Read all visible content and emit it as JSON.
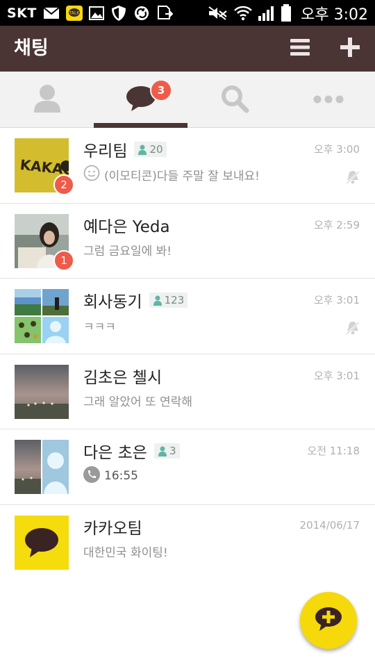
{
  "status_bar": {
    "carrier": "SKT",
    "time": "오후 3:02",
    "icons": [
      "mail-icon",
      "kakaotalk-icon",
      "image-icon",
      "shield-icon",
      "sync-icon",
      "download-icon",
      "mute-icon",
      "wifi-icon",
      "signal-icon",
      "battery-icon"
    ]
  },
  "header": {
    "title": "채팅",
    "menu_icon": "menu-icon",
    "add_icon": "plus-icon"
  },
  "tabs": {
    "items": [
      {
        "id": "friends",
        "icon": "person-icon",
        "active": false
      },
      {
        "id": "chats",
        "icon": "chat-bubble-icon",
        "active": true,
        "badge": "3"
      },
      {
        "id": "search",
        "icon": "search-icon",
        "active": false
      },
      {
        "id": "more",
        "icon": "more-dots-icon",
        "active": false
      }
    ],
    "accent": "#4a3434"
  },
  "chats": [
    {
      "name": "우리팀",
      "members": "20",
      "time": "오후 3:00",
      "preview": "(이모티콘)다들 주말 잘 보내요!",
      "preview_icon": "emoticon-icon",
      "unread": "2",
      "muted": true
    },
    {
      "name": "예다은 Yeda",
      "members": "",
      "time": "오후 2:59",
      "preview": "그럼 금요일에 봐!",
      "preview_icon": "",
      "unread": "1",
      "muted": false
    },
    {
      "name": "회사동기",
      "members": "123",
      "time": "오후 3:01",
      "preview": "ㅋㅋㅋ",
      "preview_icon": "",
      "unread": "",
      "muted": true
    },
    {
      "name": "김초은 첼시",
      "members": "",
      "time": "오후 3:01",
      "preview": "그래 알았어 또 연락해",
      "preview_icon": "",
      "unread": "",
      "muted": false
    },
    {
      "name": "다은 초은",
      "members": "3",
      "time": "오전 11:18",
      "preview": "16:55",
      "preview_icon": "phone-call-icon",
      "unread": "",
      "muted": false
    },
    {
      "name": "카카오팀",
      "members": "",
      "time": "2014/06/17",
      "preview": "대한민국 화이팅!",
      "preview_icon": "",
      "unread": "",
      "muted": false
    }
  ],
  "fab": {
    "icon": "new-chat-icon",
    "color": "#f5d90a"
  },
  "colors": {
    "header_bg": "#4a3434",
    "badge": "#ee5b4a",
    "kakao_yellow": "#f5d90a"
  }
}
